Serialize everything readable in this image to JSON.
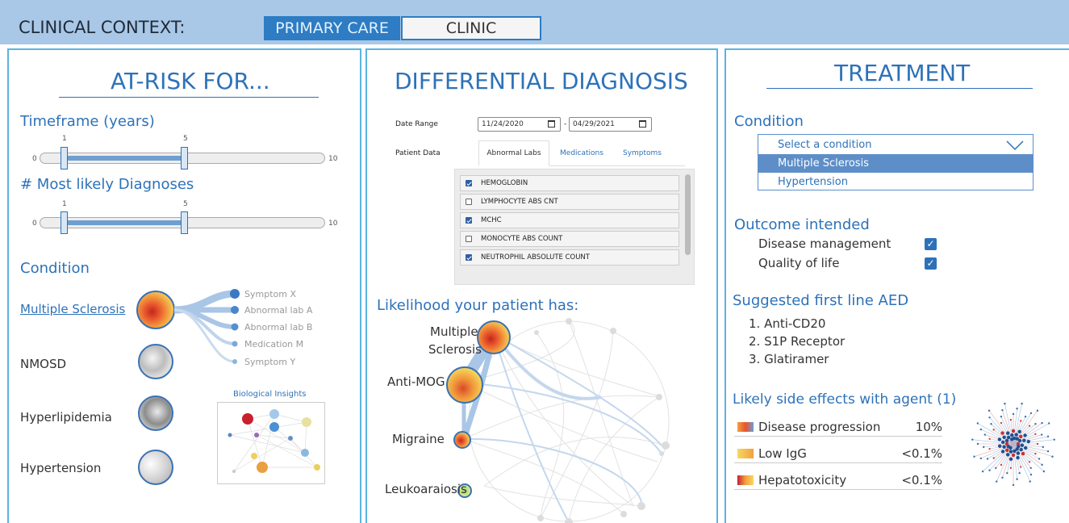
{
  "context": {
    "label": "CLINICAL CONTEXT:",
    "primary": "PRIMARY CARE",
    "clinic": "CLINIC"
  },
  "at_risk": {
    "title": "AT-RISK FOR...",
    "timeframe_label": "Timeframe (years)",
    "timeframe": {
      "min": "0",
      "max": "10",
      "low": "1",
      "high": "5"
    },
    "diagnoses_label": "# Most likely Diagnoses",
    "diagnoses": {
      "min": "0",
      "max": "10",
      "low": "1",
      "high": "5"
    },
    "condition_label": "Condition",
    "conditions": [
      "Multiple Sclerosis",
      "NMOSD",
      "Hyperlipidemia",
      "Hypertension"
    ],
    "symptoms": [
      "Symptom X",
      "Abnormal lab A",
      "Abnormal lab B",
      "Medication M",
      "Symptom Y"
    ],
    "insights_title": "Biological Insights"
  },
  "differential": {
    "title": "DIFFERENTIAL DIAGNOSIS",
    "date_range_label": "Date Range",
    "date_from": "11/24/2020",
    "date_sep": "-",
    "date_to": "04/29/2021",
    "patient_data_label": "Patient Data",
    "tabs": [
      "Abnormal Labs",
      "Medications",
      "Symptoms"
    ],
    "labs": [
      {
        "name": "HEMOGLOBIN",
        "checked": true
      },
      {
        "name": "LYMPHOCYTE ABS CNT",
        "checked": false
      },
      {
        "name": "MCHC",
        "checked": true
      },
      {
        "name": "MONOCYTE ABS COUNT",
        "checked": false
      },
      {
        "name": "NEUTROPHIL ABSOLUTE COUNT",
        "checked": true
      }
    ],
    "likelihood_label": "Likelihood your patient has:",
    "diagnoses": [
      "Multiple",
      "Sclerosis",
      "Anti-MOG",
      "Migraine",
      "Leukoaraiosis"
    ]
  },
  "treatment": {
    "title": "TREATMENT",
    "condition_label": "Condition",
    "select_placeholder": "Select a condition",
    "options": [
      "Multiple Sclerosis",
      "Hypertension"
    ],
    "outcome_label": "Outcome intended",
    "outcomes": [
      {
        "name": "Disease management",
        "checked": true
      },
      {
        "name": "Quality of life",
        "checked": true
      }
    ],
    "aed_label": "Suggested first line AED",
    "aeds": [
      "1. Anti-CD20",
      "2. S1P Receptor",
      "3. Glatiramer"
    ],
    "side_effects_label": "Likely side effects with agent (1)",
    "side_effects": [
      {
        "name": "Disease progression",
        "value": "10%"
      },
      {
        "name": "Low IgG",
        "value": "<0.1%"
      },
      {
        "name": "Hepatotoxicity",
        "value": "<0.1%"
      }
    ]
  },
  "colors": {
    "accent": "#2d72b8",
    "topbar": "#a9c7e6",
    "panel_border": "#5ab4e4"
  }
}
